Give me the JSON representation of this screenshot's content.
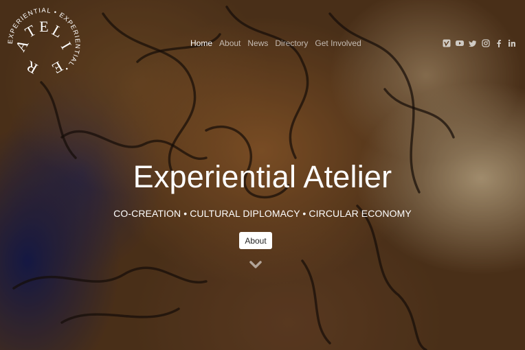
{
  "logo": {
    "ring_text": "EXPERIENTIAL • EXPERIENTIAL • ",
    "center_letters": [
      "A",
      "T",
      "E",
      "L",
      "I",
      "E",
      "R"
    ]
  },
  "nav": {
    "items": [
      {
        "label": "Home",
        "active": true
      },
      {
        "label": "About",
        "active": false
      },
      {
        "label": "News",
        "active": false
      },
      {
        "label": "Directory",
        "active": false
      },
      {
        "label": "Get Involved",
        "active": false
      }
    ]
  },
  "social": [
    "vimeo-icon",
    "youtube-icon",
    "twitter-icon",
    "instagram-icon",
    "facebook-icon",
    "linkedin-icon"
  ],
  "hero": {
    "title": "Experiential Atelier",
    "tagline": "CO-CREATION • CULTURAL DIPLOMACY • CIRCULAR ECONOMY",
    "button_label": "About"
  },
  "colors": {
    "nav_active": "#ffffff",
    "nav_inactive": "#c9c2b8",
    "button_bg": "#ffffff"
  }
}
